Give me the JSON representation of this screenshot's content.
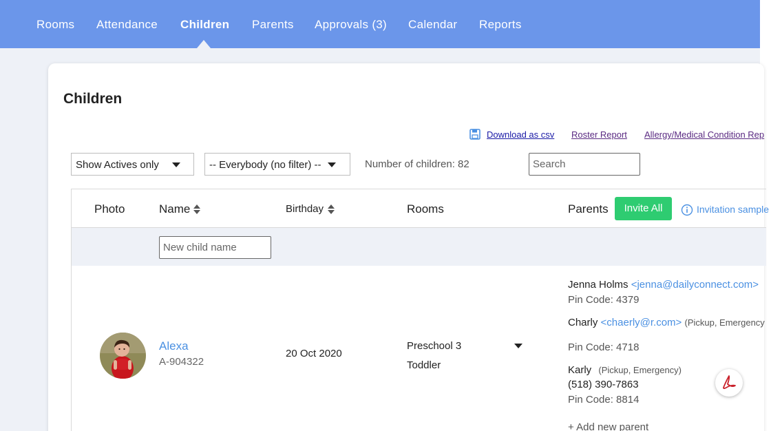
{
  "nav": {
    "items": [
      "Rooms",
      "Attendance",
      "Children",
      "Parents",
      "Approvals (3)",
      "Calendar",
      "Reports"
    ],
    "active": "Children"
  },
  "page": {
    "title": "Children"
  },
  "links": {
    "download_csv": "Download as csv",
    "roster_report": "Roster Report",
    "allergy_report": "Allergy/Medical Condition Rep"
  },
  "filters": {
    "status_selected": "Show Actives only",
    "group_selected": "-- Everybody (no filter) --",
    "count_label": "Number of children: 82",
    "search_placeholder": "Search"
  },
  "table": {
    "headers": {
      "photo": "Photo",
      "name": "Name",
      "birthday": "Birthday",
      "rooms": "Rooms",
      "parents": "Parents"
    },
    "invite_all": "Invite All",
    "invitation_sample": "Invitation sample",
    "new_child_placeholder": "New child name",
    "rows": [
      {
        "name": "Alexa",
        "id": "A-904322",
        "birthday": "20 Oct 2020",
        "rooms": [
          "Preschool 3",
          "Toddler"
        ],
        "parents": [
          {
            "name": "Jenna Holms",
            "email": "<jenna@dailyconnect.com>",
            "role": "",
            "phone": "",
            "pin": "Pin Code: 4379"
          },
          {
            "name": "Charly",
            "email": "<chaerly@r.com>",
            "role": "(Pickup, Emergency",
            "phone": "",
            "pin": "Pin Code: 4718"
          },
          {
            "name": "Karly",
            "email": "",
            "role": "(Pickup, Emergency)",
            "phone": "(518) 390-7863",
            "pin": "Pin Code: 8814"
          }
        ],
        "add_parent": "+ Add new parent"
      }
    ]
  },
  "colors": {
    "nav_bg": "#6b96ea",
    "accent_link": "#4a90e2",
    "invite_green": "#2ecc71"
  }
}
